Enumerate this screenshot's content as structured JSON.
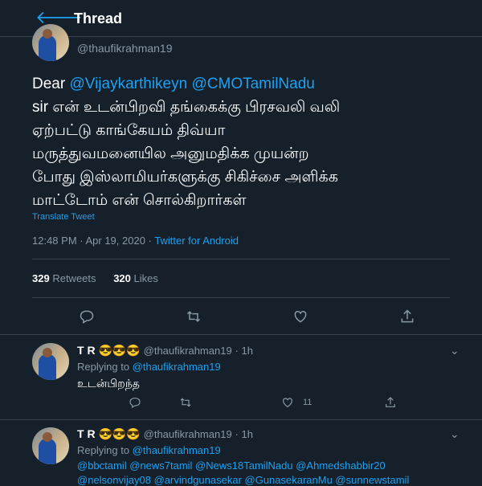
{
  "header": {
    "title": "Thread",
    "back_icon": "arrow-left-icon"
  },
  "main_tweet": {
    "handle": "@thaufikrahman19",
    "text_lead": "Dear ",
    "mention1": "@Vijaykarthikeyn",
    "mention2": "@CMOTamilNadu",
    "line2": "sir என் உடன்பிறவி தங்கைக்கு பிரசவலி வலி",
    "line3": "ஏற்பட்டு காங்கேயம் திவ்யா",
    "line4": "மருத்துவமனையில அனுமதிக்க முயன்ற",
    "line5": "போது இஸ்லாமியர்களுக்கு சிகிச்சை அளிக்க",
    "line6": "மாட்டோம் என் சொல்கிறார்கள்",
    "translate": "Translate Tweet",
    "time": "12:48 PM · Apr 19, 2020 · ",
    "app": "Twitter for Android",
    "retweets_count": "329",
    "retweets_label": "Retweets",
    "likes_count": "320",
    "likes_label": "Likes"
  },
  "replies": [
    {
      "name": "T R",
      "emoji": "😎😎😎",
      "handle": "@thaufikrahman19",
      "time": "· 1h",
      "replying_label": "Replying to ",
      "replying_to": "@thaufikrahman19",
      "text": "உடன்பிறந்த",
      "like_count": "11"
    },
    {
      "name": "T R",
      "emoji": "😎😎😎",
      "handle": "@thaufikrahman19",
      "time": "· 1h",
      "replying_label": "Replying to ",
      "replying_to": "@thaufikrahman19",
      "mentions_line1": "@bbctamil @news7tamil @News18TamilNadu @Ahmedshabbir20",
      "mentions_line2": "@nelsonvijay08 @arvindgunasekar @GunasekaranMu @sunnewstamil"
    }
  ],
  "colors": {
    "background": "#15202b",
    "accent": "#1da1f2",
    "muted": "#8899a6",
    "divider": "#38444d"
  }
}
